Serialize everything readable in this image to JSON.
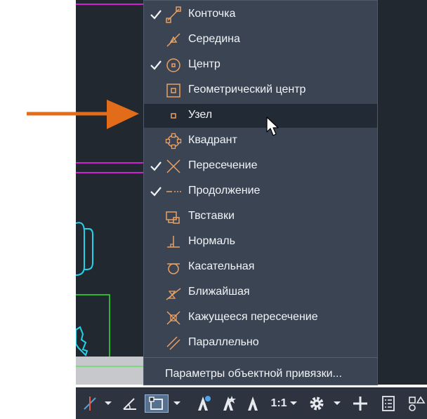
{
  "menu": {
    "items": [
      {
        "label": "Конточка",
        "checked": true,
        "icon": "endpoint-snap-icon"
      },
      {
        "label": "Середина",
        "checked": false,
        "icon": "midpoint-snap-icon"
      },
      {
        "label": "Центр",
        "checked": true,
        "icon": "center-snap-icon"
      },
      {
        "label": "Геометрический центр",
        "checked": false,
        "icon": "geometric-center-snap-icon"
      },
      {
        "label": "Узел",
        "checked": false,
        "icon": "node-snap-icon",
        "highlighted": true
      },
      {
        "label": "Квадрант",
        "checked": false,
        "icon": "quadrant-snap-icon"
      },
      {
        "label": "Пересечение",
        "checked": true,
        "icon": "intersection-snap-icon"
      },
      {
        "label": "Продолжение",
        "checked": true,
        "icon": "extension-snap-icon"
      },
      {
        "label": "Твставки",
        "checked": false,
        "icon": "insertion-snap-icon"
      },
      {
        "label": "Нормаль",
        "checked": false,
        "icon": "perpendicular-snap-icon"
      },
      {
        "label": "Касательная",
        "checked": false,
        "icon": "tangent-snap-icon"
      },
      {
        "label": "Ближайшая",
        "checked": false,
        "icon": "nearest-snap-icon"
      },
      {
        "label": "Кажущееся пересечение",
        "checked": false,
        "icon": "apparent-intersection-snap-icon"
      },
      {
        "label": "Параллельно",
        "checked": false,
        "icon": "parallel-snap-icon"
      }
    ],
    "settings_label": "Параметры объектной привязки..."
  },
  "statusbar": {
    "scale_label": "1:1",
    "icons": [
      "ortho-icon",
      "chevron-down-icon",
      "polar-angle-icon",
      "object-snap-icon",
      "chevron-down-icon",
      "annotation-visibility-icon",
      "annotation-autoscale-icon",
      "annotation-scale-icon",
      "chevron-down-icon",
      "gear-icon",
      "chevron-down-icon",
      "plus-icon",
      "properties-icon",
      "layout-icon"
    ]
  },
  "colors": {
    "menu_bg": "#3b4453",
    "menu_highlight": "#222a35",
    "snap_marker": "#e8a064",
    "callout_arrow": "#e36c1a",
    "canvas_bg": "#212830"
  }
}
